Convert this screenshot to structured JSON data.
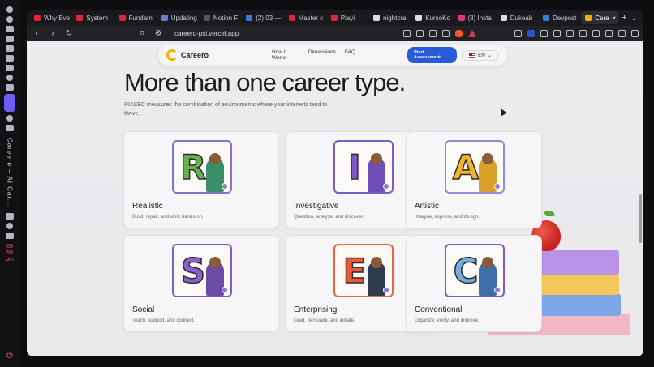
{
  "dock": {
    "title": "Careero – AI Car...",
    "clock": [
      "09",
      "59",
      "pm"
    ]
  },
  "tabs": [
    {
      "label": "Why Eve",
      "color": "#e0243a"
    },
    {
      "label": "System",
      "color": "#e0243a"
    },
    {
      "label": "Fundam",
      "color": "#e0243a"
    },
    {
      "label": "Updating",
      "color": "#6c7bd6"
    },
    {
      "label": "Notion F",
      "color": "#555"
    },
    {
      "label": "(2) 03 —",
      "color": "#3a7bd5"
    },
    {
      "label": "Master c",
      "color": "#e0243a"
    },
    {
      "label": "Playi",
      "color": "#e0243a"
    },
    {
      "label": "nightcra",
      "color": "#ddd"
    },
    {
      "label": "KursoKo",
      "color": "#ddd"
    },
    {
      "label": "(3) Insta",
      "color": "#d6387a"
    },
    {
      "label": "Dukeab",
      "color": "#ddd"
    },
    {
      "label": "Devpost",
      "color": "#3a7bd5"
    },
    {
      "label": "Care",
      "color": "#f0b400",
      "active": true
    }
  ],
  "toolbar": {
    "url": "careero-psi.vercel.app"
  },
  "nav": {
    "logo": "Careero",
    "links": [
      "How It Works",
      "Dimensions",
      "FAQ"
    ],
    "cta": "Start Assessment",
    "lang": "EN"
  },
  "hero": {
    "title": "More than one career type.",
    "subtitle": "RIASEC measures the combination of environments where your interests tend to thrive."
  },
  "cards": [
    {
      "letter": "R",
      "title": "Realistic",
      "desc": "Build, repair, and work hands-on.",
      "letter_color": "#6ab04c",
      "person_color": "#3a8f6a",
      "border": "#8a6fd0"
    },
    {
      "letter": "I",
      "title": "Investigative",
      "desc": "Question, analyze, and discover.",
      "letter_color": "#7b57c8",
      "person_color": "#6e4fb8",
      "border": "#7b5cc8"
    },
    {
      "letter": "A",
      "title": "Artistic",
      "desc": "Imagine, express, and design.",
      "letter_color": "#f0b429",
      "person_color": "#d9a12a",
      "border": "#9b88d6"
    },
    {
      "letter": "S",
      "title": "Social",
      "desc": "Teach, support, and connect.",
      "letter_color": "#8a5fd0",
      "person_color": "#6a4ba8",
      "border": "#7b5cc8"
    },
    {
      "letter": "E",
      "title": "Enterprising",
      "desc": "Lead, persuade, and initiate.",
      "letter_color": "#e55a3c",
      "person_color": "#2f3a4a",
      "border": "#e2683e"
    },
    {
      "letter": "C",
      "title": "Conventional",
      "desc": "Organize, verify, and improve.",
      "letter_color": "#78a9e0",
      "person_color": "#3e6ea8",
      "border": "#7b5cc8"
    }
  ]
}
